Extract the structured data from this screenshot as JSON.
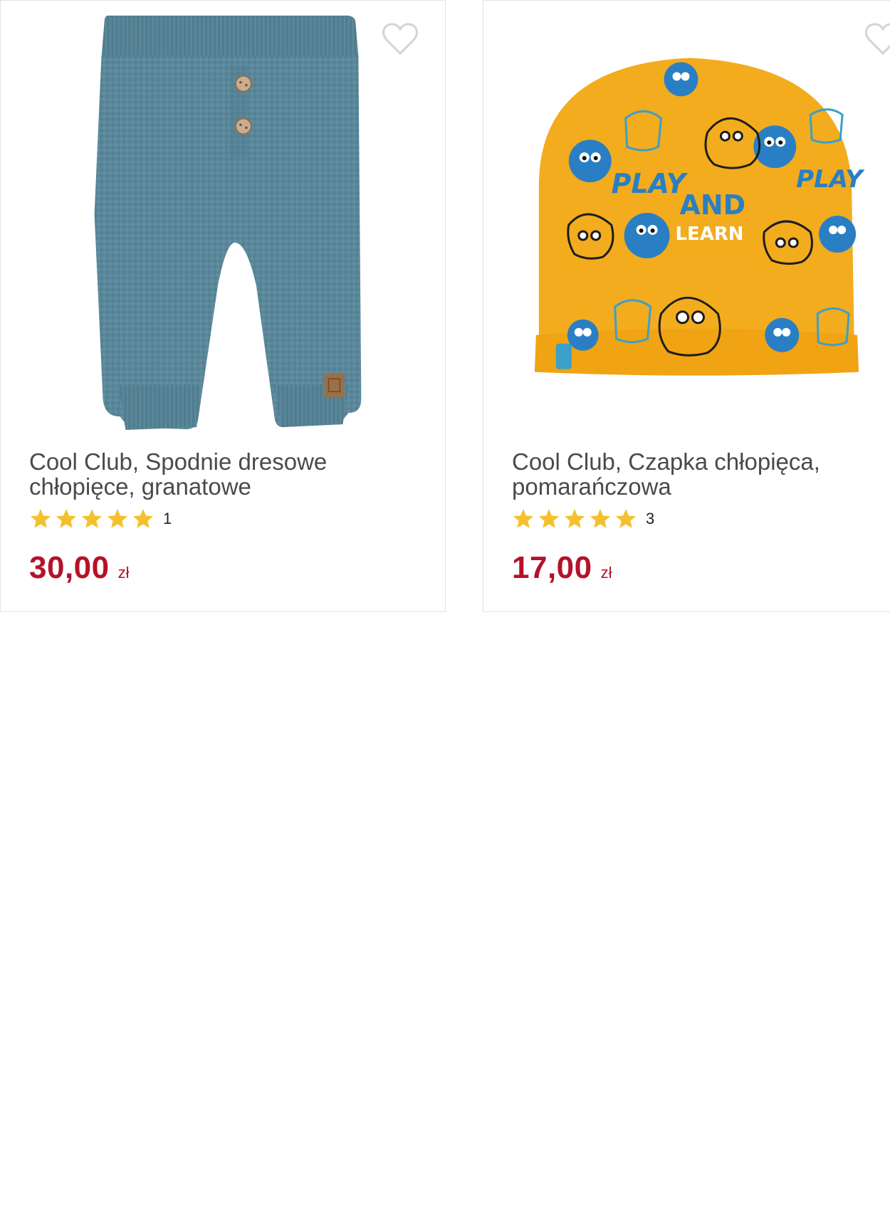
{
  "colors": {
    "price": "#b5122a",
    "star": "#f5c02f",
    "title": "#4a4a4a",
    "border": "#e3e3e3"
  },
  "products": [
    {
      "image_icon": "knit-pants-image",
      "title": "Cool Club, Spodnie dresowe chłopięce, granatowe",
      "rating_stars": 5,
      "rating_count": "1",
      "price": "30,00",
      "currency": "zł"
    },
    {
      "image_icon": "beanie-hat-image",
      "title": "Cool Club, Czapka chłopięca, pomarańczowa",
      "rating_stars": 5,
      "rating_count": "3",
      "price": "17,00",
      "currency": "zł"
    }
  ]
}
